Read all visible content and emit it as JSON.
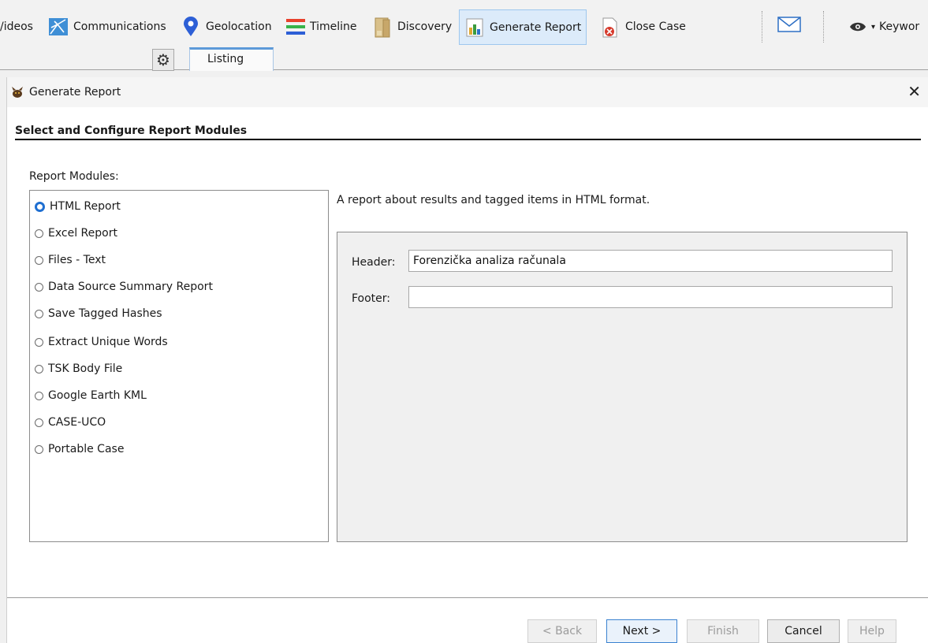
{
  "toolbar": {
    "items": [
      {
        "label": "/ideos",
        "icon": "videos-icon"
      },
      {
        "label": "Communications",
        "icon": "communications-icon"
      },
      {
        "label": "Geolocation",
        "icon": "location-pin-icon"
      },
      {
        "label": "Timeline",
        "icon": "timeline-icon"
      },
      {
        "label": "Discovery",
        "icon": "discovery-icon"
      },
      {
        "label": "Generate Report",
        "icon": "report-icon"
      },
      {
        "label": "Close Case",
        "icon": "close-case-icon"
      }
    ],
    "keyword_label": "Keywor"
  },
  "tabs": {
    "listing": "Listing"
  },
  "dialog": {
    "title": "Generate Report",
    "step_title": "Select and Configure Report Modules",
    "modules_label": "Report Modules:",
    "modules": [
      {
        "label": "HTML Report",
        "selected": true
      },
      {
        "label": "Excel Report",
        "selected": false
      },
      {
        "label": "Files - Text",
        "selected": false
      },
      {
        "label": "Data Source Summary Report",
        "selected": false
      },
      {
        "label": "Save Tagged Hashes",
        "selected": false
      },
      {
        "label": "Extract Unique Words",
        "selected": false
      },
      {
        "label": "TSK Body File",
        "selected": false
      },
      {
        "label": "Google Earth KML",
        "selected": false
      },
      {
        "label": "CASE-UCO",
        "selected": false
      },
      {
        "label": "Portable Case",
        "selected": false
      }
    ],
    "description": "A report about results and tagged items in HTML format.",
    "config": {
      "header_label": "Header:",
      "header_value": "Forenzička analiza računala",
      "footer_label": "Footer:",
      "footer_value": ""
    },
    "buttons": {
      "back": "< Back",
      "next": "Next >",
      "finish": "Finish",
      "cancel": "Cancel",
      "help": "Help"
    }
  },
  "colors": {
    "accent": "#1f6fd1",
    "active_tool_bg": "#dcebfa",
    "tab_accent": "#5d9ad8"
  }
}
